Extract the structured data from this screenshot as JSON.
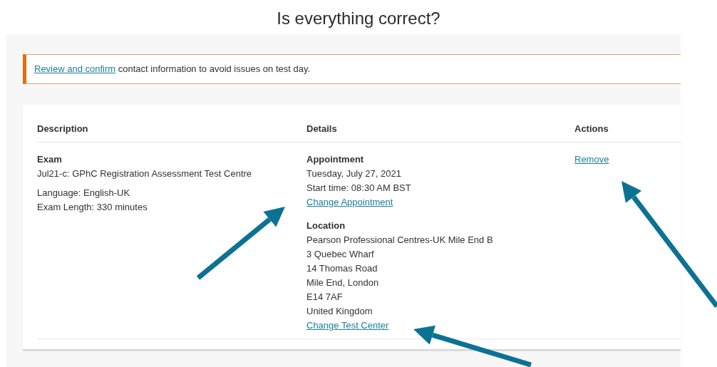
{
  "title": "Is everything correct?",
  "alert": {
    "link": "Review and confirm",
    "text": "contact information to avoid issues on test day."
  },
  "table": {
    "columns": [
      "Description",
      "Details",
      "Actions"
    ],
    "rows": [
      {
        "description": {
          "heading": "Exam",
          "name": "Jul21-c: GPhC Registration Assessment Test Centre",
          "lines": [
            "Language: English-UK",
            "Exam Length: 330 minutes"
          ]
        },
        "details": [
          {
            "heading": "Appointment",
            "lines": [
              "Tuesday, July 27, 2021",
              "Start time: 08:30 AM BST"
            ],
            "link": "Change Appointment"
          },
          {
            "heading": "Location",
            "lines": [
              "Pearson Professional Centres-UK Mile End B",
              "3 Quebec Wharf",
              "14 Thomas Road",
              "Mile End, London",
              "E14 7AF",
              "United Kingdom"
            ],
            "link": "Change Test Center"
          }
        ],
        "actions": [
          "Remove"
        ]
      }
    ]
  }
}
